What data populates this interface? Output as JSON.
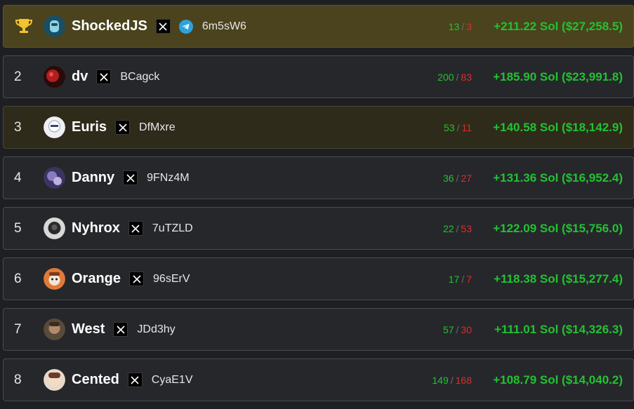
{
  "leaderboard": [
    {
      "rank": "",
      "trophy": "trophy-icon",
      "name": "ShockedJS",
      "socials": [
        "x-icon",
        "telegram-icon"
      ],
      "wallet": "6m5sW6",
      "wins": "13",
      "losses": "3",
      "pnl": "+211.22 Sol ($27,258.5)",
      "highlight": "gold",
      "avatar_color": "#1a4e63"
    },
    {
      "rank": "2",
      "name": "dv",
      "socials": [
        "x-icon"
      ],
      "wallet": "BCagck",
      "wins": "200",
      "losses": "83",
      "pnl": "+185.90 Sol ($23,991.8)",
      "highlight": "none",
      "avatar_color": "#8b1a1a"
    },
    {
      "rank": "3",
      "name": "Euris",
      "socials": [
        "x-icon"
      ],
      "wallet": "DfMxre",
      "wins": "53",
      "losses": "11",
      "pnl": "+140.58 Sol ($18,142.9)",
      "highlight": "bronze",
      "avatar_color": "#e8e8f0"
    },
    {
      "rank": "4",
      "name": "Danny",
      "socials": [
        "x-icon"
      ],
      "wallet": "9FNz4M",
      "wins": "36",
      "losses": "27",
      "pnl": "+131.36 Sol ($16,952.4)",
      "highlight": "none",
      "avatar_color": "#6a5a9a"
    },
    {
      "rank": "5",
      "name": "Nyhrox",
      "socials": [
        "x-icon"
      ],
      "wallet": "7uTZLD",
      "wins": "22",
      "losses": "53",
      "pnl": "+122.09 Sol ($15,756.0)",
      "highlight": "none",
      "avatar_color": "#3a3a3a"
    },
    {
      "rank": "6",
      "name": "Orange",
      "socials": [
        "x-icon"
      ],
      "wallet": "96sErV",
      "wins": "17",
      "losses": "7",
      "pnl": "+118.38 Sol ($15,277.4)",
      "highlight": "none",
      "avatar_color": "#e07a3a"
    },
    {
      "rank": "7",
      "name": "West",
      "socials": [
        "x-icon"
      ],
      "wallet": "JDd3hy",
      "wins": "57",
      "losses": "30",
      "pnl": "+111.01 Sol ($14,326.3)",
      "highlight": "none",
      "avatar_color": "#7a5a45"
    },
    {
      "rank": "8",
      "name": "Cented",
      "socials": [
        "x-icon"
      ],
      "wallet": "CyaE1V",
      "wins": "149",
      "losses": "168",
      "pnl": "+108.79 Sol ($14,040.2)",
      "highlight": "none",
      "avatar_color": "#c8a890"
    }
  ],
  "colors": {
    "win": "#22c232",
    "loss": "#e02b2b",
    "gold_row": "#4b431d",
    "bronze_row": "#2e2b1b"
  }
}
